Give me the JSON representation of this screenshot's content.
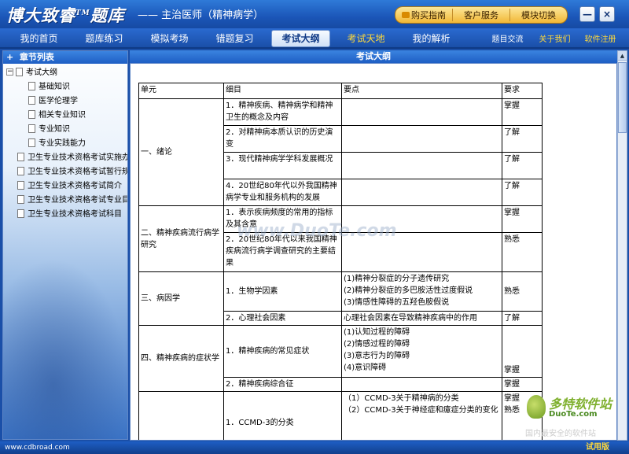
{
  "app": {
    "logo_main": "博大致睿",
    "logo_tm": "TM",
    "logo_tail": "题库",
    "subtitle": "—— 主治医师（精神病学）",
    "top_buttons": [
      "购买指南",
      "客户服务",
      "模块切换"
    ],
    "min_label": "—",
    "close_label": "×"
  },
  "nav": {
    "items": [
      "我的首页",
      "题库练习",
      "模拟考场",
      "错题复习",
      "考试大纲",
      "考试天地",
      "我的解析"
    ],
    "right_items": [
      "题目交流",
      "关于我们",
      "软件注册"
    ]
  },
  "sidebar": {
    "title": "章节列表",
    "root": "考试大纲",
    "children": [
      "基础知识",
      "医学伦理学",
      "相关专业知识",
      "专业知识",
      "专业实践能力"
    ],
    "others": [
      "卫生专业技术资格考试实施办",
      "卫生专业技术资格考试暂行规",
      "卫生专业技术资格考试简介",
      "卫生专业技术资格考试专业目",
      "卫生专业技术资格考试科目"
    ]
  },
  "main": {
    "title": "考试大纲",
    "headers": [
      "单元",
      "细目",
      "要点",
      "要求"
    ],
    "rows": [
      {
        "unit": "一、绪论",
        "detail": "1．精神疾病、精神病学和精神卫生的概念及内容",
        "points": "",
        "req": "掌握"
      },
      {
        "detail": "2．对精神病本质认识的历史演变",
        "points": "",
        "req": "了解"
      },
      {
        "detail": "3．现代精神病学学科发展概况",
        "points": "",
        "req": "了解"
      },
      {
        "detail": "4．20世纪80年代以外我国精神病学专业和服务机构的发展",
        "points": "",
        "req": "了解"
      },
      {
        "unit": "二、精神疾病流行病学研究",
        "detail": "1．表示疾病频度的常用的指标及其含意",
        "points": "",
        "req": "掌握"
      },
      {
        "detail": "2．20世纪80年代以来我国精神疾病流行病学调查研究的主要结果",
        "points": "",
        "req": "熟悉"
      },
      {
        "unit": "三、病因学",
        "detail": "1．生物学因素",
        "points": "(1)精神分裂症的分子遗传研究\n(2)精神分裂症的多巴胺活性过度假说\n(3)情感性障碍的五羟色胺假说",
        "req": "熟悉"
      },
      {
        "detail": "2．心理社会因素",
        "points": "心理社会因素在导致精神疾病中的作用",
        "req": "了解"
      },
      {
        "unit": "四、精神疾病的症状学",
        "detail": "1．精神疾病的常见症状",
        "points": "(1)认知过程的障碍\n(2)情感过程的障碍\n(3)意志行为的障碍\n(4)意识障碍",
        "req": "掌握"
      },
      {
        "detail": "2．精神疾病综合征",
        "points": "",
        "req": "掌握"
      },
      {
        "unit": "",
        "detail": "1．CCMD-3的分类",
        "points": "（1）CCMD-3关于精神病的分类\n（2）CCMD-3关于神经症和癔症分类的变化",
        "req": "掌握\n熟悉"
      }
    ]
  },
  "watermark": "www.DuoTe.com",
  "corner_logo": {
    "brand": "多特软件站",
    "url": "DuoTe.com",
    "slogan": "国内最安全的软件站"
  },
  "status": {
    "url": "www.cdbroad.com",
    "version": "试用版"
  }
}
